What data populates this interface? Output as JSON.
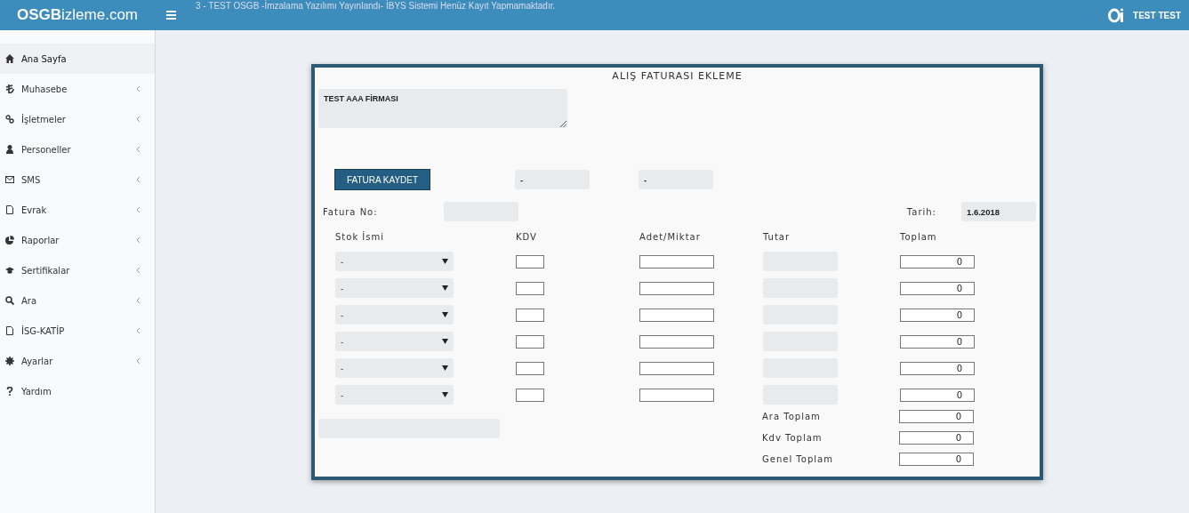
{
  "header": {
    "logo_bold": "OSGB",
    "logo_rest": "izleme.com",
    "announcement": "3 - TEST OSGB -İmzalama Yazılımı Yayınlandı- İBYS Sistemi Henüz Kayıt Yapmamaktadır.",
    "user": "TEST TEST"
  },
  "sidebar": {
    "items": [
      {
        "label": "Ana Sayfa",
        "selected": true,
        "expandable": false
      },
      {
        "label": "Muhasebe",
        "selected": false,
        "expandable": true
      },
      {
        "label": "İşletmeler",
        "selected": false,
        "expandable": true
      },
      {
        "label": "Personeller",
        "selected": false,
        "expandable": true
      },
      {
        "label": "SMS",
        "selected": false,
        "expandable": true
      },
      {
        "label": "Evrak",
        "selected": false,
        "expandable": true
      },
      {
        "label": "Raporlar",
        "selected": false,
        "expandable": true
      },
      {
        "label": "Sertifikalar",
        "selected": false,
        "expandable": true
      },
      {
        "label": "Ara",
        "selected": false,
        "expandable": true
      },
      {
        "label": "İSG-KATİP",
        "selected": false,
        "expandable": true
      },
      {
        "label": "Ayarlar",
        "selected": false,
        "expandable": true
      },
      {
        "label": "Yardım",
        "selected": false,
        "expandable": false
      }
    ]
  },
  "form": {
    "title": "ALIŞ FATURASI EKLEME",
    "company": "TEST AAA FİRMASI",
    "save_button": "FATURA KAYDET",
    "info_1": "-",
    "info_2": "-",
    "invoice_no_label": "Fatura No:",
    "date_label": "Tarih:",
    "date": "1.6.2018",
    "columns": [
      "Stok İsmi",
      "KDV",
      "Adet/Miktar",
      "Tutar",
      "Toplam"
    ],
    "rows": [
      {
        "stock": "-",
        "total": "0"
      },
      {
        "stock": "-",
        "total": "0"
      },
      {
        "stock": "-",
        "total": "0"
      },
      {
        "stock": "-",
        "total": "0"
      },
      {
        "stock": "-",
        "total": "0"
      },
      {
        "stock": "-",
        "total": "0"
      }
    ],
    "summary": [
      {
        "label": "Ara Toplam",
        "value": "0"
      },
      {
        "label": "Kdv Toplam",
        "value": "0"
      },
      {
        "label": "Genel Toplam",
        "value": "0"
      }
    ]
  }
}
